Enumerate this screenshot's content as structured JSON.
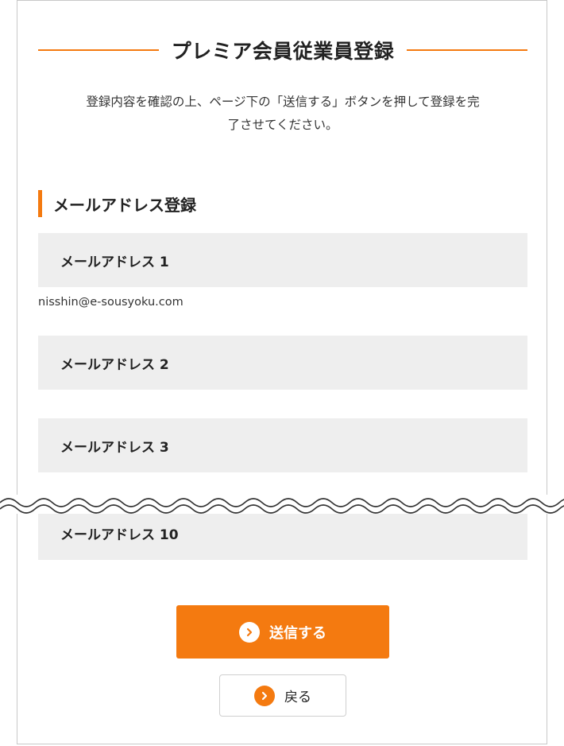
{
  "page": {
    "title": "プレミア会員従業員登録",
    "intro_line1": "登録内容を確認の上、ページ下の「送信する」ボタンを押して登録を完",
    "intro_line2": "了させてください。"
  },
  "section": {
    "title": "メールアドレス登録"
  },
  "fields": [
    {
      "label": "メールアドレス 1",
      "value": "nisshin@e-sousyoku.com"
    },
    {
      "label": "メールアドレス 2",
      "value": ""
    },
    {
      "label": "メールアドレス 3",
      "value": ""
    },
    {
      "label": "メールアドレス 10",
      "value": ""
    }
  ],
  "buttons": {
    "submit_label": "送信する",
    "back_label": "戻る"
  },
  "colors": {
    "accent": "#f47a10",
    "field_bg": "#eeeeee",
    "border": "#c8c8c8"
  },
  "icons": {
    "submit": "chevron-right-circle-icon",
    "back": "chevron-right-circle-icon"
  }
}
